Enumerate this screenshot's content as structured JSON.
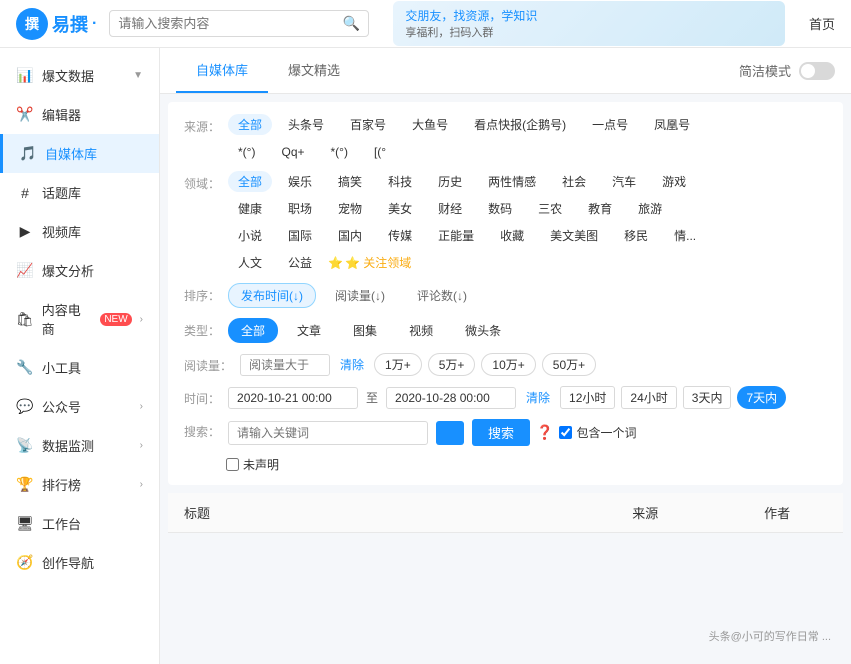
{
  "topbar": {
    "logo_text": "易撰",
    "logo_icon": "撰",
    "search_placeholder": "请输入搜索内容",
    "banner": {
      "text1": "交朋友，找资源，学知识",
      "text2": "享福利，扫码入群"
    },
    "nav_link": "首页"
  },
  "sidebar": {
    "items": [
      {
        "id": "baowendata",
        "icon": "📊",
        "label": "爆文数据",
        "has_arrow": true,
        "active": false
      },
      {
        "id": "bianji",
        "icon": "✂️",
        "label": "编辑器",
        "has_arrow": false,
        "active": false
      },
      {
        "id": "ziwei",
        "icon": "🎵",
        "label": "自媒体库",
        "has_arrow": false,
        "active": true
      },
      {
        "id": "huati",
        "icon": "#",
        "label": "话题库",
        "has_arrow": false,
        "active": false
      },
      {
        "id": "video",
        "icon": "▶",
        "label": "视频库",
        "has_arrow": false,
        "active": false
      },
      {
        "id": "baowenfenxi",
        "icon": "📈",
        "label": "爆文分析",
        "has_arrow": false,
        "active": false
      },
      {
        "id": "neirong",
        "icon": "",
        "label": "内容电商",
        "has_arrow": true,
        "active": false,
        "badge": "NEW"
      },
      {
        "id": "xiaogongju",
        "icon": "",
        "label": "小工具",
        "has_arrow": false,
        "active": false
      },
      {
        "id": "gongzonghao",
        "icon": "",
        "label": "公众号",
        "has_arrow": true,
        "active": false
      },
      {
        "id": "shujujiance",
        "icon": "",
        "label": "数据监测",
        "has_arrow": true,
        "active": false
      },
      {
        "id": "paihangjbang",
        "icon": "",
        "label": "排行榜",
        "has_arrow": true,
        "active": false
      },
      {
        "id": "gongtai",
        "icon": "",
        "label": "工作台",
        "has_arrow": false,
        "active": false
      },
      {
        "id": "chuangyuandaohang",
        "icon": "",
        "label": "创作导航",
        "has_arrow": false,
        "active": false
      }
    ]
  },
  "tabs": {
    "items": [
      {
        "id": "ziwei",
        "label": "自媒体库",
        "active": true
      },
      {
        "id": "baowenjingxuan",
        "label": "爆文精选",
        "active": false
      },
      {
        "id": "jianjianmoshi",
        "label": "简洁模式",
        "active": false
      }
    ],
    "simple_mode_label": "简洁模式"
  },
  "filters": {
    "source_label": "来源：",
    "source_options": [
      {
        "label": "全部",
        "active": true
      },
      {
        "label": "头条号",
        "active": false
      },
      {
        "label": "百家号",
        "active": false
      },
      {
        "label": "大鱼号",
        "active": false
      },
      {
        "label": "看点快报(企鹅号)",
        "active": false
      },
      {
        "label": "一点号",
        "active": false
      },
      {
        "label": "凤凰号",
        "active": false
      },
      {
        "label": "*(°)",
        "active": false
      },
      {
        "label": "Qq+",
        "active": false
      },
      {
        "label": "*(°)",
        "active": false
      },
      {
        "label": "[(°",
        "active": false
      }
    ],
    "domain_label": "领域：",
    "domain_options_row1": [
      {
        "label": "全部",
        "active": true
      },
      {
        "label": "娱乐",
        "active": false
      },
      {
        "label": "搞笑",
        "active": false
      },
      {
        "label": "科技",
        "active": false
      },
      {
        "label": "历史",
        "active": false
      },
      {
        "label": "两性情感",
        "active": false
      },
      {
        "label": "社会",
        "active": false
      },
      {
        "label": "汽车",
        "active": false
      },
      {
        "label": "游戏",
        "active": false
      }
    ],
    "domain_options_row2": [
      {
        "label": "健康",
        "active": false
      },
      {
        "label": "职场",
        "active": false
      },
      {
        "label": "宠物",
        "active": false
      },
      {
        "label": "美女",
        "active": false
      },
      {
        "label": "财经",
        "active": false
      },
      {
        "label": "数码",
        "active": false
      },
      {
        "label": "三农",
        "active": false
      },
      {
        "label": "教育",
        "active": false
      },
      {
        "label": "旅游",
        "active": false
      }
    ],
    "domain_options_row3": [
      {
        "label": "小说",
        "active": false
      },
      {
        "label": "国际",
        "active": false
      },
      {
        "label": "国内",
        "active": false
      },
      {
        "label": "传媒",
        "active": false
      },
      {
        "label": "正能量",
        "active": false
      },
      {
        "label": "收藏",
        "active": false
      },
      {
        "label": "美文美图",
        "active": false
      },
      {
        "label": "移民",
        "active": false
      },
      {
        "label": "情...",
        "active": false
      }
    ],
    "domain_options_row4": [
      {
        "label": "人文",
        "active": false
      },
      {
        "label": "公益",
        "active": false
      }
    ],
    "attention_label": "⭐ 关注领域",
    "sort_label": "排序：",
    "sort_options": [
      {
        "label": "发布时间(↓)",
        "active": true
      },
      {
        "label": "阅读量(↓)",
        "active": false
      },
      {
        "label": "评论数(↓)",
        "active": false
      }
    ],
    "type_label": "类型：",
    "type_options": [
      {
        "label": "全部",
        "active": true
      },
      {
        "label": "文章",
        "active": false
      },
      {
        "label": "图集",
        "active": false
      },
      {
        "label": "视频",
        "active": false
      },
      {
        "label": "微头条",
        "active": false
      }
    ],
    "read_label": "阅读量：",
    "read_placeholder": "阅读量大于",
    "read_clear": "清除",
    "read_counts": [
      "1万+",
      "5万+",
      "10万+",
      "50万+"
    ],
    "time_label": "时间：",
    "time_from": "2020-10-21 00:00",
    "time_to": "2020-10-28 00:00",
    "time_clear": "清除",
    "time_options": [
      {
        "label": "12小时",
        "active": false
      },
      {
        "label": "24小时",
        "active": false
      },
      {
        "label": "3天内",
        "active": false
      },
      {
        "label": "7天内",
        "active": true
      }
    ],
    "search_label": "搜索：",
    "search_placeholder": "请输入关键词",
    "search_button": "搜索",
    "include_one_word_label": "包含一个词",
    "undeclared_label": "未声明"
  },
  "table": {
    "columns": [
      "标题",
      "来源",
      "作者"
    ]
  },
  "watermark": "头条@小可的写作日常 ..."
}
